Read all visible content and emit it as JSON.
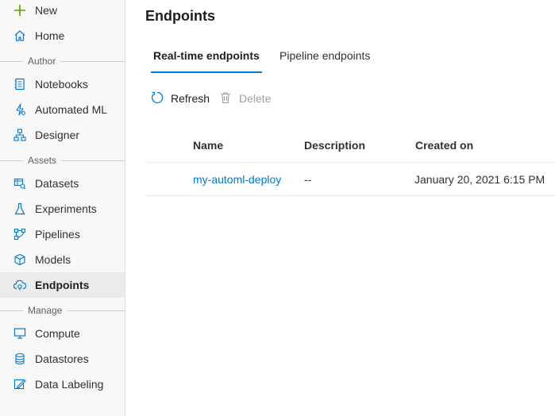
{
  "sidebar": {
    "new_label": "New",
    "home_label": "Home",
    "sections": {
      "author": "Author",
      "assets": "Assets",
      "manage": "Manage"
    },
    "items": {
      "notebooks": "Notebooks",
      "automated_ml": "Automated ML",
      "designer": "Designer",
      "datasets": "Datasets",
      "experiments": "Experiments",
      "pipelines": "Pipelines",
      "models": "Models",
      "endpoints": "Endpoints",
      "compute": "Compute",
      "datastores": "Datastores",
      "data_labeling": "Data Labeling"
    },
    "selected": "endpoints"
  },
  "main": {
    "title": "Endpoints",
    "tabs": [
      {
        "label": "Real-time endpoints",
        "active": true
      },
      {
        "label": "Pipeline endpoints",
        "active": false
      }
    ],
    "commands": {
      "refresh": "Refresh",
      "delete": "Delete"
    },
    "table": {
      "columns": [
        "Name",
        "Description",
        "Created on"
      ],
      "rows": [
        {
          "name": "my-automl-deploy",
          "description": "--",
          "created_on": "January 20, 2021 6:15 PM"
        }
      ]
    }
  },
  "colors": {
    "accent": "#0078d4",
    "new_plus": "#57a300",
    "sidebar_bg": "#f8f8f8",
    "selected_bg": "#ebebeb"
  }
}
